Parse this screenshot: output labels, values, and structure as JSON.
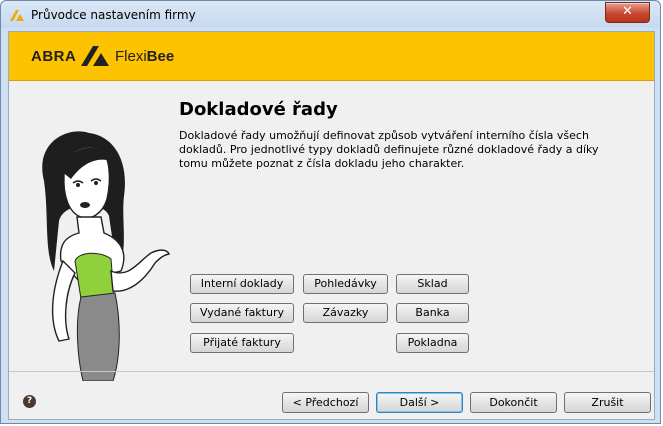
{
  "window": {
    "title": "Průvodce nastavením firmy",
    "close_label": "✕"
  },
  "logo": {
    "abra": "ABRA",
    "flexi": "Flexi",
    "bee": "Bee"
  },
  "page": {
    "heading": "Dokladové řady",
    "description": "Dokladové řady umožňují definovat způsob vytváření interního čísla všech dokladů. Pro jednotlivé typy dokladů definujete různé dokladové řady a díky tomu můžete poznat z čísla dokladu jeho charakter."
  },
  "categories": {
    "interni": "Interní doklady",
    "vydane": "Vydané faktury",
    "prijate": "Přijaté faktury",
    "pohledavky": "Pohledávky",
    "zavazky": "Závazky",
    "sklad": "Sklad",
    "banka": "Banka",
    "pokladna": "Pokladna"
  },
  "footer": {
    "help": "?",
    "previous": "< Předchozí",
    "next": "Další >",
    "finish": "Dokončit",
    "cancel": "Zrušit"
  },
  "colors": {
    "banner": "#fec300",
    "accent_border": "#3c7fb1"
  }
}
